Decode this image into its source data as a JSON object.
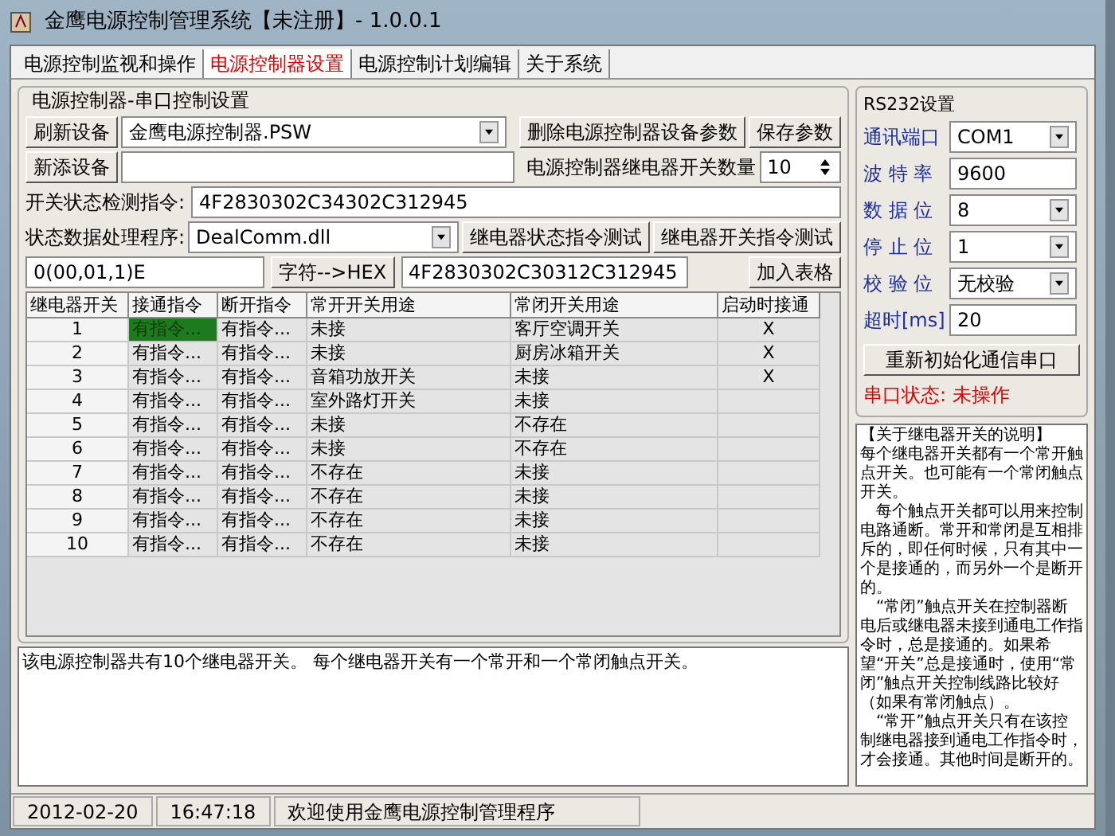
{
  "window": {
    "title": "金鹰电源控制管理系统【未注册】- 1.0.0.1"
  },
  "tabs": [
    {
      "label": "电源控制监视和操作",
      "selected": false
    },
    {
      "label": "电源控制器设置",
      "selected": true
    },
    {
      "label": "电源控制计划编辑",
      "selected": false
    },
    {
      "label": "关于系统",
      "selected": false
    }
  ],
  "controller_group": {
    "title": "电源控制器-串口控制设置",
    "refresh_button": "刷新设备",
    "device_select": "金鹰电源控制器.PSW",
    "delete_button": "删除电源控制器设备参数",
    "save_button": "保存参数",
    "add_button": "新添设备",
    "relay_count_label": "电源控制器继电器开关数量",
    "relay_count": "10",
    "detect_label": "开关状态检测指令:",
    "detect_value": "4F2830302C34302C312945",
    "handler_label": "状态数据处理程序:",
    "handler_value": "DealComm.dll",
    "status_test_button": "继电器状态指令测试",
    "switch_test_button": "继电器开关指令测试",
    "char_input": "0(00,01,1)E",
    "convert_button": "字符-->HEX",
    "hex_value": "4F2830302C30312C312945",
    "add_table_button": "加入表格"
  },
  "table": {
    "columns": [
      "继电器开关",
      "接通指令",
      "断开指令",
      "常开开关用途",
      "常闭开关用途",
      "启动时接通"
    ],
    "rows": [
      {
        "cells": [
          "1",
          "有指令...",
          "有指令...",
          "未接",
          "客厅空调开关",
          "X"
        ],
        "selected": true
      },
      {
        "cells": [
          "2",
          "有指令...",
          "有指令...",
          "未接",
          "厨房冰箱开关",
          "X"
        ],
        "selected": false
      },
      {
        "cells": [
          "3",
          "有指令...",
          "有指令...",
          "音箱功放开关",
          "未接",
          "X"
        ],
        "selected": false
      },
      {
        "cells": [
          "4",
          "有指令...",
          "有指令...",
          "室外路灯开关",
          "未接",
          ""
        ],
        "selected": false
      },
      {
        "cells": [
          "5",
          "有指令...",
          "有指令...",
          "未接",
          "不存在",
          ""
        ],
        "selected": false
      },
      {
        "cells": [
          "6",
          "有指令...",
          "有指令...",
          "未接",
          "不存在",
          ""
        ],
        "selected": false
      },
      {
        "cells": [
          "7",
          "有指令...",
          "有指令...",
          "不存在",
          "未接",
          ""
        ],
        "selected": false
      },
      {
        "cells": [
          "8",
          "有指令...",
          "有指令...",
          "不存在",
          "未接",
          ""
        ],
        "selected": false
      },
      {
        "cells": [
          "9",
          "有指令...",
          "有指令...",
          "不存在",
          "未接",
          ""
        ],
        "selected": false
      },
      {
        "cells": [
          "10",
          "有指令...",
          "有指令...",
          "不存在",
          "未接",
          ""
        ],
        "selected": false
      }
    ]
  },
  "info_text": "该电源控制器共有10个继电器开关。 每个继电器开关有一个常开和一个常闭触点开关。",
  "rs232": {
    "title": "RS232设置",
    "fields": [
      {
        "label": "通讯端口",
        "value": "COM1",
        "kind": "select"
      },
      {
        "label": "波 特 率",
        "value": "9600",
        "kind": "input"
      },
      {
        "label": "数 据 位",
        "value": "8",
        "kind": "select"
      },
      {
        "label": "停 止 位",
        "value": "1",
        "kind": "select"
      },
      {
        "label": "校 验 位",
        "value": "无校验",
        "kind": "select"
      },
      {
        "label": "超时[ms]",
        "value": "20",
        "kind": "input"
      }
    ],
    "reinit_button": "重新初始化通信串口",
    "port_status": "串口状态: 未操作"
  },
  "help": [
    "【关于继电器开关的说明】",
    "每个继电器开关都有一个常开触点开关。也可能有一个常闭触点开关。",
    "　每个触点开关都可以用来控制电路通断。常开和常闭是互相排斥的，即任何时候，只有其中一个是接通的，而另外一个是断开的。",
    "　“常闭”触点开关在控制器断电后或继电器未接到通电工作指令时，总是接通的。如果希望“开关”总是接通时，使用“常闭”触点开关控制线路比较好（如果有常闭触点）。",
    "　“常开”触点开关只有在该控制继电器接到通电工作指令时，才会接通。其他时间是断开的。"
  ],
  "status_bar": [
    "2012-02-20",
    "16:47:18",
    "欢迎使用金鹰电源控制管理程序"
  ]
}
